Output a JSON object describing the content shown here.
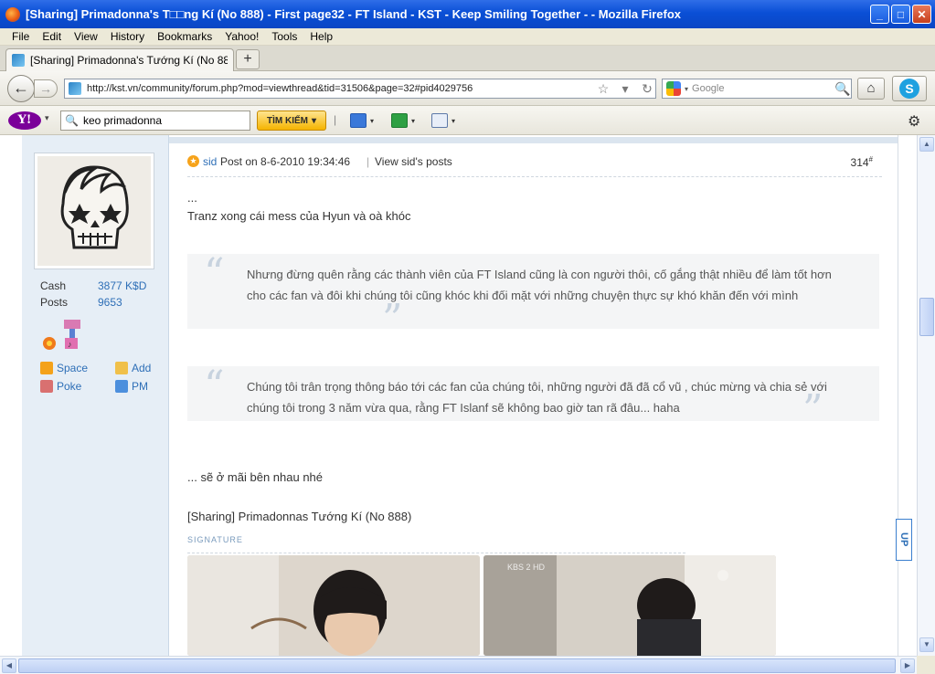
{
  "window": {
    "title": "[Sharing] Primadonna's T□□ng Kí (No 888) - First page32 - FT Island - KST - Keep Smiling Together - - Mozilla Firefox",
    "minimize": "_",
    "maximize": "□",
    "close": "✕"
  },
  "menu": [
    "File",
    "Edit",
    "View",
    "History",
    "Bookmarks",
    "Yahoo!",
    "Tools",
    "Help"
  ],
  "tab": {
    "title": "[Sharing] Primadonna's Tướng Kí (No 888) - ...",
    "close": "✕",
    "new_tab": "+"
  },
  "nav": {
    "back": "←",
    "forward": "→",
    "url": "http://kst.vn/community/forum.php?mod=viewthread&tid=31506&page=32#pid4029756",
    "bookmark_star": "☆",
    "url_dropdown": "▾",
    "reload": "↻",
    "search_placeholder": "Google",
    "search_engine_dropdown": "▾",
    "search_go": "🔍",
    "home": "⌂",
    "skype": "S"
  },
  "yahoo_toolbar": {
    "logo": "Y!",
    "logo_dropdown": "▾",
    "search_value": "keo primadonna",
    "search_button": "TÌM KIẾM",
    "search_button_dropdown": "▾",
    "separator": "|",
    "dropdown": "▾",
    "settings": "⚙"
  },
  "sidebar": {
    "stats": [
      {
        "label": "Cash",
        "value": "3877 K$D"
      },
      {
        "label": "Posts",
        "value": "9653"
      }
    ],
    "links": [
      {
        "label": "Space"
      },
      {
        "label": "Add"
      },
      {
        "label": "Poke"
      },
      {
        "label": "PM"
      }
    ]
  },
  "post": {
    "author": "sid",
    "posted_on": "Post on 8-6-2010 19:34:46",
    "pipe": "|",
    "view_posts": "View sid's posts",
    "floor": "314",
    "floor_sup": "#",
    "line1": "...",
    "line2": "Tranz xong cái mess của Hyun và oà khóc",
    "quote_open_mark": "“",
    "quote_close_mark": "”",
    "quote1": "Nhưng đừng quên rằng các thành viên của FT Island cũng là con người thôi, cố gắng thật nhiều để làm tốt hơn cho các fan và đôi khi chúng tôi cũng khóc khi  đối mặt với những chuyện  thực sự khó khăn đến với mình",
    "quote2": "Chúng tôi trân trọng thông báo tới các fan của chúng tôi, những người đã đã cổ vũ , chúc mừng và chia sẻ với chúng tôi trong 3 năm vừa qua, rằng FT Islanf sẽ không bao giờ tan rã đâu... haha",
    "closing": "... sẽ ở mãi bên nhau nhé",
    "thread_title": "[Sharing] Primadonnas Tướng Kí (No 888)",
    "signature_label": "SIGNATURE",
    "photo2_watermark": "KBS 2 HD"
  },
  "up_button": "UP",
  "scroll": {
    "up": "▲",
    "down": "▼",
    "left": "◀",
    "right": "▶"
  }
}
